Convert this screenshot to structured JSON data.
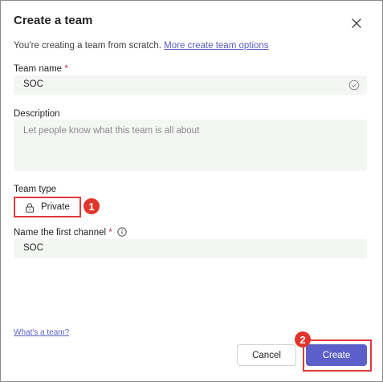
{
  "dialog": {
    "title": "Create a team",
    "intro_text": "You're creating a team from scratch.",
    "intro_link": "More create team options"
  },
  "team_name": {
    "label": "Team name",
    "required_mark": "*",
    "value": "SOC"
  },
  "description": {
    "label": "Description",
    "placeholder": "Let people know what this team is all about"
  },
  "team_type": {
    "label": "Team type",
    "value": "Private"
  },
  "first_channel": {
    "label": "Name the first channel",
    "required_mark": "*",
    "value": "SOC"
  },
  "footer": {
    "whats_team_link": "What's a team?",
    "cancel_label": "Cancel",
    "create_label": "Create"
  },
  "annotations": {
    "badge_1": "1",
    "badge_2": "2"
  },
  "colors": {
    "accent": "#5b5fc7",
    "annotation_red": "#e0362c",
    "field_bg": "#f3f6f3"
  }
}
